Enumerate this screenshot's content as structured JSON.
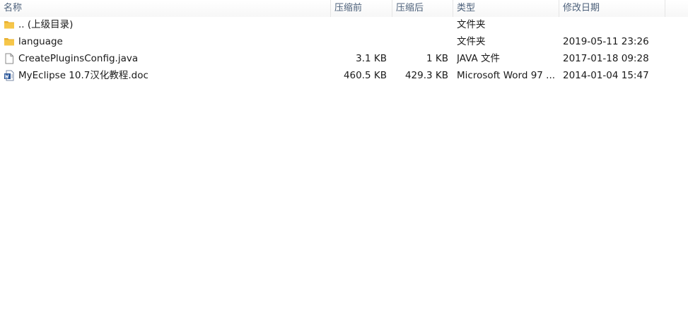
{
  "columns": {
    "name": "名称",
    "compressed": "压缩前",
    "uncompressed": "压缩后",
    "type": "类型",
    "modified": "修改日期"
  },
  "rows": [
    {
      "name": ".. (上级目录)",
      "icon": "folder-icon",
      "size_before": "",
      "size_after": "",
      "type": "文件夹",
      "modified": ""
    },
    {
      "name": "language",
      "icon": "folder-icon",
      "size_before": "",
      "size_after": "",
      "type": "文件夹",
      "modified": "2019-05-11 23:26"
    },
    {
      "name": "CreatePluginsConfig.java",
      "icon": "file-icon",
      "size_before": "3.1 KB",
      "size_after": "1 KB",
      "type": "JAVA 文件",
      "modified": "2017-01-18 09:28"
    },
    {
      "name": "MyEclipse 10.7汉化教程.doc",
      "icon": "word-doc-icon",
      "size_before": "460.5 KB",
      "size_after": "429.3 KB",
      "type": "Microsoft Word 97 ...",
      "modified": "2014-01-04 15:47"
    }
  ],
  "colors": {
    "header_text": "#4c607a",
    "folder": "#f6c649",
    "word": "#2b579a"
  }
}
